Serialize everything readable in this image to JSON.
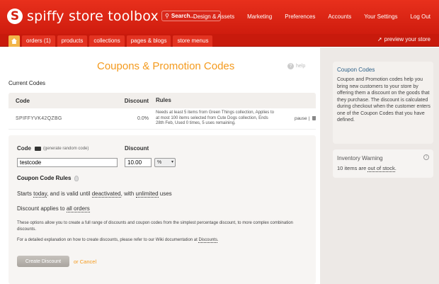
{
  "header": {
    "logo_letter": "S",
    "logo_text": "spiffy store toolbox",
    "search_placeholder": "Search...",
    "nav": [
      "Design & Assets",
      "Marketing",
      "Preferences",
      "Accounts",
      "Your Settings",
      "Log Out"
    ]
  },
  "tabs": {
    "items": [
      "orders (1)",
      "products",
      "collections",
      "pages & blogs",
      "store menus"
    ],
    "preview": "preview your store"
  },
  "main": {
    "title": "Coupons & Promotion Codes",
    "help": "help",
    "current_codes": "Current Codes",
    "table": {
      "headers": [
        "Code",
        "Discount",
        "Rules"
      ],
      "rows": [
        {
          "code": "SPIFFYVK42QZBG",
          "discount": "0.0%",
          "rules": "Needs at least 5 items from Green Things collection, Applies to at most 100 items selected from Cute Dogs collection, Ends 28th Feb, Used 0 times, 5 uses remaining.",
          "pause": "pause",
          "sep": "|"
        }
      ]
    }
  },
  "form": {
    "code_label": "Code",
    "generate_link": "(generate random code)",
    "discount_label": "Discount",
    "code_value": "testcode",
    "discount_value": "10.00",
    "discount_unit": "%",
    "rules_title": "Coupon Code Rules",
    "rule_parts": [
      "Starts ",
      "today",
      ", and is valid until ",
      "deactivated",
      ", with ",
      "unlimited",
      " uses"
    ],
    "applies_prefix": "Discount applies to ",
    "applies_target": "all orders",
    "note1": "These options allow you to create a full range of discounts and coupon codes from the simplest percentage discount, to more complex combination discounts.",
    "note2_prefix": "For a detailed explanation on how to create discounts, please refer to our Wiki documentation at ",
    "note2_link": "Discounts",
    "note2_suffix": ".",
    "create_button": "Create Discount",
    "or": "or",
    "cancel": "Cancel"
  },
  "sidebar": {
    "coupon_title": "Coupon Codes",
    "coupon_body": "Coupon and Promotion codes help you bring new customers to your store by offering them a discount on the goods that they purchase. The discount is calculated during checkout when the customer enters one of the Coupon Codes that you have defined.",
    "inventory_title": "Inventory Warning",
    "inventory_prefix": "10 items are ",
    "inventory_link": "out of stock",
    "inventory_suffix": "."
  },
  "colors": {
    "brand_red": "#d21f0f",
    "accent_orange": "#f49a1d",
    "sidebar_title_blue": "#2b5f87"
  }
}
